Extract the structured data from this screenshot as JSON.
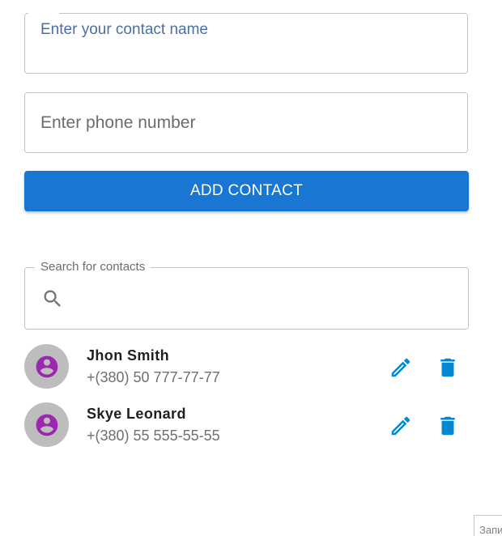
{
  "form": {
    "name_label": "Enter your contact name",
    "phone_placeholder": "Enter phone number",
    "add_button_label": "ADD CONTACT"
  },
  "search": {
    "label": "Search for contacts",
    "value": ""
  },
  "contacts": [
    {
      "name": "Jhon Smith",
      "phone": "+(380) 50 777-77-77"
    },
    {
      "name": "Skye Leonard",
      "phone": "+(380) 55 555-55-55"
    }
  ],
  "corner_tooltip": {
    "text": "Запи"
  },
  "colors": {
    "primary": "#1976d2",
    "action_icon": "#0288d1",
    "avatar_bg": "#bdbdbd",
    "avatar_icon": "#9c27b0"
  },
  "icons": {
    "search": "search-icon",
    "avatar": "account-circle-icon",
    "edit": "pencil-icon",
    "delete": "trash-icon"
  }
}
